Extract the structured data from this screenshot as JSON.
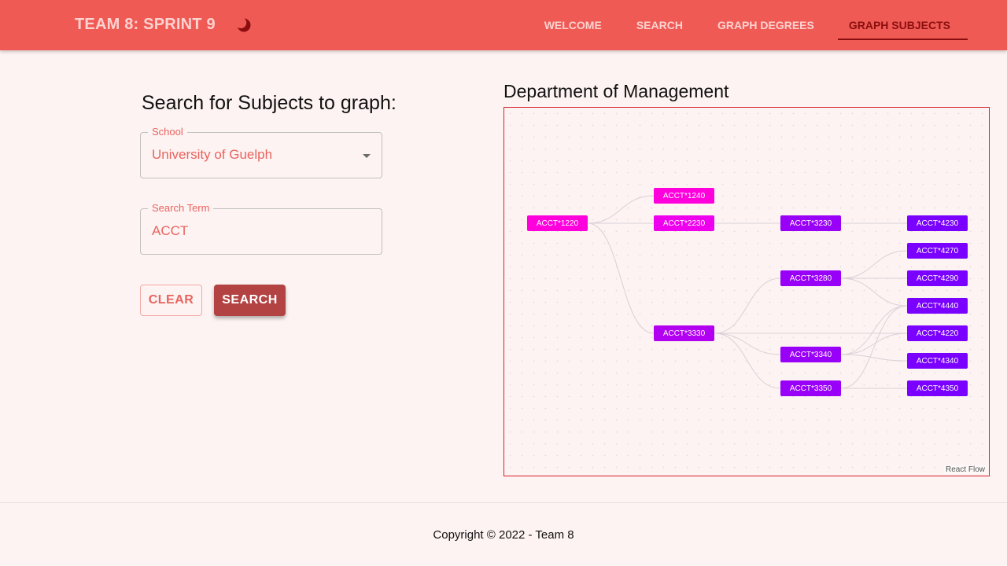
{
  "header": {
    "brand": "TEAM 8: SPRINT 9",
    "theme_toggle_icon": "moon-icon",
    "nav": [
      {
        "label": "WELCOME"
      },
      {
        "label": "SEARCH"
      },
      {
        "label": "GRAPH DEGREES"
      },
      {
        "label": "GRAPH SUBJECTS",
        "active": true
      }
    ]
  },
  "search_panel": {
    "title": "Search for Subjects to graph:",
    "school": {
      "label": "School",
      "value": "University of Guelph"
    },
    "search_term": {
      "label": "Search Term",
      "value": "ACCT"
    },
    "clear_label": "CLEAR",
    "search_label": "SEARCH"
  },
  "graph": {
    "title": "Department of Management",
    "attribution": "React Flow",
    "nodes": [
      {
        "id": "ACCT*1220",
        "label": "ACCT*1220",
        "color": "#ff00dd"
      },
      {
        "id": "ACCT*1240",
        "label": "ACCT*1240",
        "color": "#ff00dd"
      },
      {
        "id": "ACCT*2230",
        "label": "ACCT*2230",
        "color": "#ee00ee"
      },
      {
        "id": "ACCT*3330",
        "label": "ACCT*3330",
        "color": "#b200f0"
      },
      {
        "id": "ACCT*3230",
        "label": "ACCT*3230",
        "color": "#9900f8"
      },
      {
        "id": "ACCT*3280",
        "label": "ACCT*3280",
        "color": "#9900f8"
      },
      {
        "id": "ACCT*3340",
        "label": "ACCT*3340",
        "color": "#9900f8"
      },
      {
        "id": "ACCT*3350",
        "label": "ACCT*3350",
        "color": "#9900f8"
      },
      {
        "id": "ACCT*4230",
        "label": "ACCT*4230",
        "color": "#7a00ff"
      },
      {
        "id": "ACCT*4270",
        "label": "ACCT*4270",
        "color": "#7a00ff"
      },
      {
        "id": "ACCT*4290",
        "label": "ACCT*4290",
        "color": "#7a00ff"
      },
      {
        "id": "ACCT*4440",
        "label": "ACCT*4440",
        "color": "#7a00ff"
      },
      {
        "id": "ACCT*4220",
        "label": "ACCT*4220",
        "color": "#7a00ff"
      },
      {
        "id": "ACCT*4340",
        "label": "ACCT*4340",
        "color": "#7a00ff"
      },
      {
        "id": "ACCT*4350",
        "label": "ACCT*4350",
        "color": "#7a00ff"
      }
    ],
    "edges": [
      [
        "ACCT*1220",
        "ACCT*1240"
      ],
      [
        "ACCT*1220",
        "ACCT*2230"
      ],
      [
        "ACCT*1220",
        "ACCT*3330"
      ],
      [
        "ACCT*2230",
        "ACCT*3230"
      ],
      [
        "ACCT*3230",
        "ACCT*4230"
      ],
      [
        "ACCT*3330",
        "ACCT*3280"
      ],
      [
        "ACCT*3330",
        "ACCT*3340"
      ],
      [
        "ACCT*3330",
        "ACCT*3350"
      ],
      [
        "ACCT*3330",
        "ACCT*4220"
      ],
      [
        "ACCT*3280",
        "ACCT*4270"
      ],
      [
        "ACCT*3280",
        "ACCT*4290"
      ],
      [
        "ACCT*3280",
        "ACCT*4440"
      ],
      [
        "ACCT*3340",
        "ACCT*4440"
      ],
      [
        "ACCT*3340",
        "ACCT*4220"
      ],
      [
        "ACCT*3340",
        "ACCT*4340"
      ],
      [
        "ACCT*3350",
        "ACCT*4440"
      ],
      [
        "ACCT*3350",
        "ACCT*4350"
      ]
    ]
  },
  "footer": {
    "text": "Copyright © 2022 - Team 8"
  }
}
